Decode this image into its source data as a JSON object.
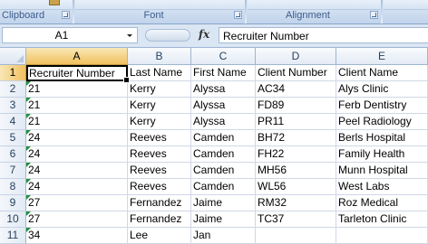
{
  "ribbon": {
    "groups": [
      {
        "label": "Clipboard"
      },
      {
        "label": "Font"
      },
      {
        "label": "Alignment"
      }
    ]
  },
  "formula_bar": {
    "name_box": "A1",
    "fx_label": "fx",
    "content": "Recruiter Number"
  },
  "columns": [
    "A",
    "B",
    "C",
    "D",
    "E"
  ],
  "selected_cell": "A1",
  "rows": [
    {
      "num": "1",
      "cells": [
        "Recruiter Number",
        "Last Name",
        "First Name",
        "Client Number",
        "Client Name"
      ]
    },
    {
      "num": "2",
      "cells": [
        "21",
        "Kerry",
        "Alyssa",
        "AC34",
        "Alys Clinic"
      ]
    },
    {
      "num": "3",
      "cells": [
        "21",
        "Kerry",
        "Alyssa",
        "FD89",
        "Ferb Dentistry"
      ]
    },
    {
      "num": "4",
      "cells": [
        "21",
        "Kerry",
        "Alyssa",
        "PR11",
        "Peel Radiology"
      ]
    },
    {
      "num": "5",
      "cells": [
        "24",
        "Reeves",
        "Camden",
        "BH72",
        "Berls Hospital"
      ]
    },
    {
      "num": "6",
      "cells": [
        "24",
        "Reeves",
        "Camden",
        "FH22",
        "Family Health"
      ]
    },
    {
      "num": "7",
      "cells": [
        "24",
        "Reeves",
        "Camden",
        "MH56",
        "Munn Hospital"
      ]
    },
    {
      "num": "8",
      "cells": [
        "24",
        "Reeves",
        "Camden",
        "WL56",
        "West Labs"
      ]
    },
    {
      "num": "9",
      "cells": [
        "27",
        "Fernandez",
        "Jaime",
        "RM32",
        "Roz Medical"
      ]
    },
    {
      "num": "10",
      "cells": [
        "27",
        "Fernandez",
        "Jaime",
        "TC37",
        "Tarleton Clinic"
      ]
    },
    {
      "num": "11",
      "cells": [
        "34",
        "Lee",
        "Jan",
        "",
        ""
      ]
    }
  ]
}
